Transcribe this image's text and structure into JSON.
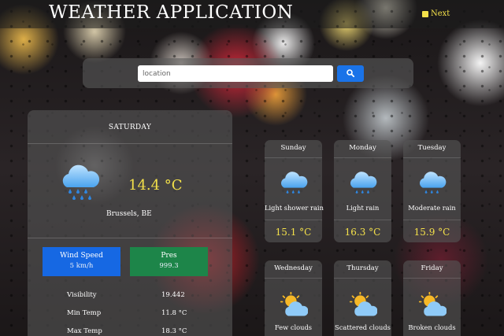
{
  "header": {
    "title": "WEATHER APPLICATION",
    "next_label": "Next"
  },
  "search": {
    "placeholder": "location",
    "value": ""
  },
  "today": {
    "day": "SATURDAY",
    "temperature": "14.4 °C",
    "location": "Brussels, BE",
    "icon": "rain-cloud-icon",
    "wind_speed": {
      "label": "Wind Speed",
      "value": "5 km/h"
    },
    "pressure": {
      "label": "Pres",
      "value": "999.3"
    },
    "details": [
      {
        "label": "Visibility",
        "value": "19.442"
      },
      {
        "label": "Min Temp",
        "value": "11.8 °C"
      },
      {
        "label": "Max Temp",
        "value": "18.3 °C"
      }
    ]
  },
  "forecast": [
    {
      "day": "Sunday",
      "description": "Light shower rain",
      "temperature": "15.1 °C",
      "icon": "rain-cloud-icon"
    },
    {
      "day": "Monday",
      "description": "Light rain",
      "temperature": "16.3 °C",
      "icon": "rain-cloud-icon"
    },
    {
      "day": "Tuesday",
      "description": "Moderate rain",
      "temperature": "15.9 °C",
      "icon": "rain-cloud-icon"
    },
    {
      "day": "Wednesday",
      "description": "Few clouds",
      "icon": "sun-cloud-icon"
    },
    {
      "day": "Thursday",
      "description": "Scattered clouds",
      "icon": "sun-cloud-icon"
    },
    {
      "day": "Friday",
      "description": "Broken clouds",
      "icon": "sun-cloud-icon"
    }
  ],
  "colors": {
    "accent_yellow": "#f3e04a",
    "wind_blue": "#1668e3",
    "pressure_green": "#1d8549",
    "search_blue": "#1a73e8"
  }
}
